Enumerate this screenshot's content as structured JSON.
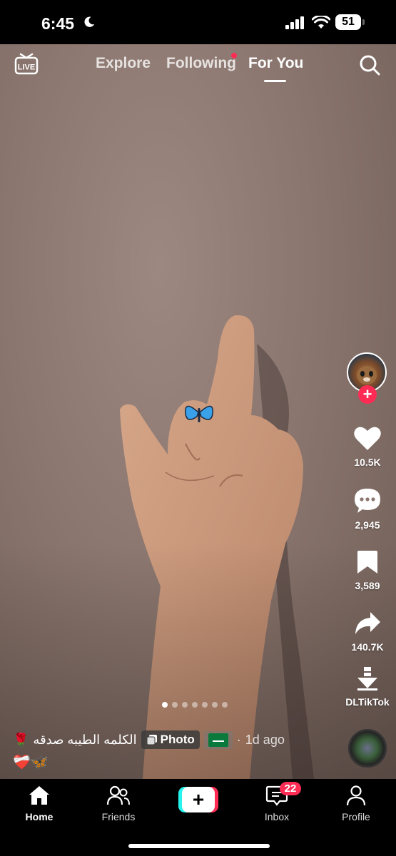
{
  "status_bar": {
    "time": "6:45",
    "battery": "51"
  },
  "top_nav": {
    "live_label": "LIVE",
    "tabs": [
      {
        "label": "Explore"
      },
      {
        "label": "Following"
      },
      {
        "label": "For You"
      }
    ],
    "active_tab": "For You"
  },
  "side_actions": {
    "likes": "10.5K",
    "comments": "2,945",
    "saves": "3,589",
    "shares": "140.7K",
    "download_label": "DLTikTok"
  },
  "carousel": {
    "total": 7,
    "current": 1
  },
  "post": {
    "caption": "الكلمه الطيبه صدقه",
    "caption_emoji": "🌹",
    "chip_label": "Photo",
    "time_ago": "1d ago",
    "emoji_line": "❤️‍🩹🦋"
  },
  "bottom_nav": {
    "items": [
      {
        "label": "Home"
      },
      {
        "label": "Friends"
      },
      {
        "label": "Inbox"
      },
      {
        "label": "Profile"
      }
    ],
    "inbox_badge": "22"
  },
  "colors": {
    "accent": "#fe2c55",
    "cyan": "#25f4ee"
  }
}
